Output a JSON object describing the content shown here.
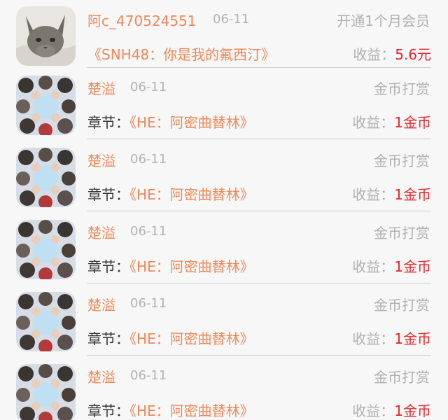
{
  "colors": {
    "accent_orange": "#f0885a",
    "income_red": "#e8262b",
    "muted_gray": "#b0b0b0",
    "background": "#f7f7f7"
  },
  "records": [
    {
      "avatar_icon": "cat-photo-avatar",
      "name": "阿c_470524551",
      "date": "06-11",
      "type": "开通1个月会员",
      "detail_label": "",
      "detail_title": "《SNH48：你是我的氟西汀》",
      "income_label": "收益：",
      "income_amount": "5.6元"
    },
    {
      "avatar_icon": "group-photo-avatar",
      "name": "楚溢",
      "date": "06-11",
      "type": "金币打赏",
      "detail_label": "章节：",
      "detail_title": "《HE：阿密曲替林》",
      "income_label": "收益：",
      "income_amount": "1金币"
    },
    {
      "avatar_icon": "group-photo-avatar",
      "name": "楚溢",
      "date": "06-11",
      "type": "金币打赏",
      "detail_label": "章节：",
      "detail_title": "《HE：阿密曲替林》",
      "income_label": "收益：",
      "income_amount": "1金币"
    },
    {
      "avatar_icon": "group-photo-avatar",
      "name": "楚溢",
      "date": "06-11",
      "type": "金币打赏",
      "detail_label": "章节：",
      "detail_title": "《HE：阿密曲替林》",
      "income_label": "收益：",
      "income_amount": "1金币"
    },
    {
      "avatar_icon": "group-photo-avatar",
      "name": "楚溢",
      "date": "06-11",
      "type": "金币打赏",
      "detail_label": "章节：",
      "detail_title": "《HE：阿密曲替林》",
      "income_label": "收益：",
      "income_amount": "1金币"
    },
    {
      "avatar_icon": "group-photo-avatar",
      "name": "楚溢",
      "date": "06-11",
      "type": "金币打赏",
      "detail_label": "章节：",
      "detail_title": "《HE：阿密曲替林》",
      "income_label": "收益：",
      "income_amount": "1金币"
    }
  ]
}
